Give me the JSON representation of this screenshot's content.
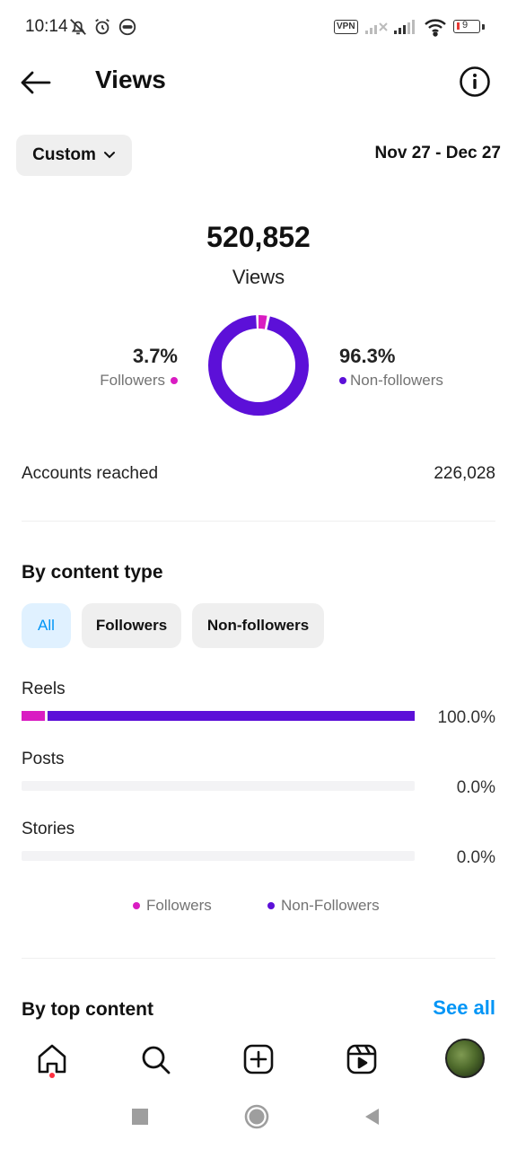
{
  "status_bar": {
    "time": "10:14",
    "vpn_label": "VPN",
    "battery_level": "9"
  },
  "header": {
    "title": "Views",
    "back_icon": "arrow-left-icon",
    "info_icon": "info-icon"
  },
  "period": {
    "selector_label": "Custom",
    "date_range": "Nov 27 - Dec 27"
  },
  "summary": {
    "total_views": "520,852",
    "views_label": "Views",
    "followers_pct": "3.7%",
    "followers_label": "Followers",
    "non_followers_pct": "96.3%",
    "non_followers_label": "Non-followers",
    "accounts_reached_label": "Accounts reached",
    "accounts_reached_value": "226,028"
  },
  "chart_data": {
    "type": "pie",
    "labels": [
      "Followers",
      "Non-followers"
    ],
    "values": [
      3.7,
      96.3
    ],
    "colors": [
      "#d91cc2",
      "#5c10d8"
    ],
    "donut": true
  },
  "content_type": {
    "title": "By content type",
    "filters": [
      {
        "label": "All",
        "active": true
      },
      {
        "label": "Followers",
        "active": false
      },
      {
        "label": "Non-followers",
        "active": false
      }
    ],
    "rows": [
      {
        "label": "Reels",
        "pct": "100.0%",
        "followers_share": 3.7,
        "non_followers_share": 96.3
      },
      {
        "label": "Posts",
        "pct": "0.0%",
        "followers_share": 0,
        "non_followers_share": 0
      },
      {
        "label": "Stories",
        "pct": "0.0%",
        "followers_share": 0,
        "non_followers_share": 0
      }
    ],
    "legend": [
      "Followers",
      "Non-Followers"
    ]
  },
  "top_content": {
    "title": "By top content",
    "see_all": "See all"
  },
  "colors": {
    "followers": "#d91cc2",
    "non_followers": "#5c10d8",
    "accent_blue": "#0095f6"
  },
  "bottom_nav": {
    "items": [
      "home-icon",
      "search-icon",
      "create-icon",
      "reels-icon",
      "profile-avatar"
    ]
  },
  "system_nav": [
    "recents-icon",
    "home-icon",
    "back-icon"
  ]
}
